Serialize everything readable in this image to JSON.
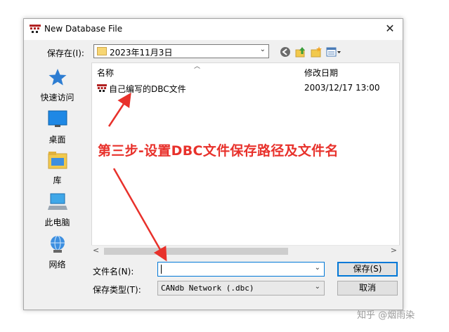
{
  "window": {
    "title": "New Database File",
    "close_glyph": "✕"
  },
  "toolbar": {
    "save_in_label": "保存在(I):",
    "location_value": "2023年11月3日",
    "icons": [
      "back-icon",
      "up-folder-icon",
      "new-folder-icon",
      "view-menu-icon"
    ]
  },
  "sidebar": {
    "items": [
      {
        "label": "快速访问",
        "icon": "quick-access-star-icon"
      },
      {
        "label": "桌面",
        "icon": "desktop-icon"
      },
      {
        "label": "库",
        "icon": "library-icon"
      },
      {
        "label": "此电脑",
        "icon": "this-pc-icon"
      },
      {
        "label": "网络",
        "icon": "network-icon"
      }
    ]
  },
  "filelist": {
    "col_name": "名称",
    "col_modified": "修改日期",
    "files": [
      {
        "name": "自己编写的DBC文件",
        "modified": "2003/12/17 13:00",
        "icon": "dbc-file-icon"
      }
    ]
  },
  "annotation": {
    "text": "第三步-设置DBC文件保存路径及文件名",
    "color": "#e8312b"
  },
  "footer": {
    "filename_label": "文件名(N):",
    "filename_value": "",
    "filetype_label": "保存类型(T):",
    "filetype_value": "CANdb Network (.dbc)",
    "save_label": "保存(S)",
    "cancel_label": "取消"
  },
  "watermark": "知乎 @烟雨染",
  "colors": {
    "accent": "#0078d7",
    "annotation_red": "#e8312b"
  }
}
